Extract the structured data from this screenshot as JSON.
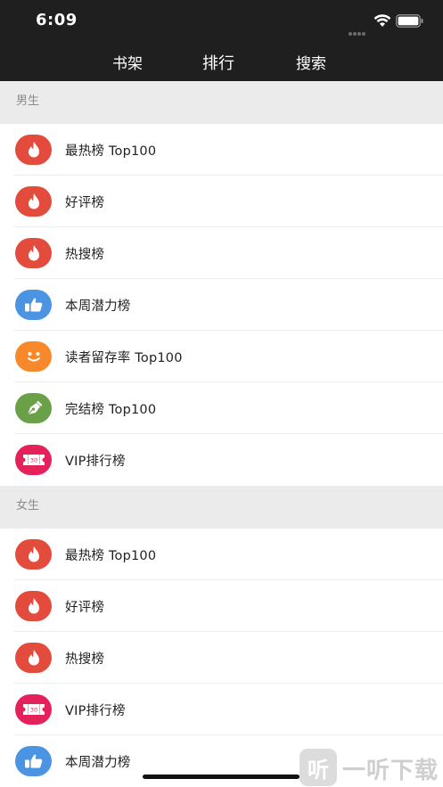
{
  "status_bar": {
    "time": "6:09"
  },
  "nav": {
    "tabs": [
      "书架",
      "排行",
      "搜索"
    ],
    "active_tab": "排行"
  },
  "sections": [
    {
      "title": "男生",
      "items": [
        {
          "label": "最热榜 Top100",
          "icon": "flame-icon",
          "color": "#e34b3c"
        },
        {
          "label": "好评榜",
          "icon": "flame-icon",
          "color": "#e34b3c"
        },
        {
          "label": "热搜榜",
          "icon": "flame-icon",
          "color": "#e34b3c"
        },
        {
          "label": "本周潜力榜",
          "icon": "thumbs-up-icon",
          "color": "#4b93e3"
        },
        {
          "label": "读者留存率 Top100",
          "icon": "smiley-icon",
          "color": "#f7892a"
        },
        {
          "label": "完结榜 Top100",
          "icon": "pen-icon",
          "color": "#6aa148"
        },
        {
          "label": "VIP排行榜",
          "icon": "ticket-icon",
          "color": "#e4215b",
          "icon_text": "30"
        }
      ]
    },
    {
      "title": "女生",
      "items": [
        {
          "label": "最热榜 Top100",
          "icon": "flame-icon",
          "color": "#e34b3c"
        },
        {
          "label": "好评榜",
          "icon": "flame-icon",
          "color": "#e34b3c"
        },
        {
          "label": "热搜榜",
          "icon": "flame-icon",
          "color": "#e34b3c"
        },
        {
          "label": "VIP排行榜",
          "icon": "ticket-icon",
          "color": "#e4215b",
          "icon_text": "30"
        },
        {
          "label": "本周潜力榜",
          "icon": "thumbs-up-icon",
          "color": "#4b93e3"
        }
      ]
    }
  ],
  "watermark": {
    "logo_text": "听",
    "text": "一听下载"
  }
}
